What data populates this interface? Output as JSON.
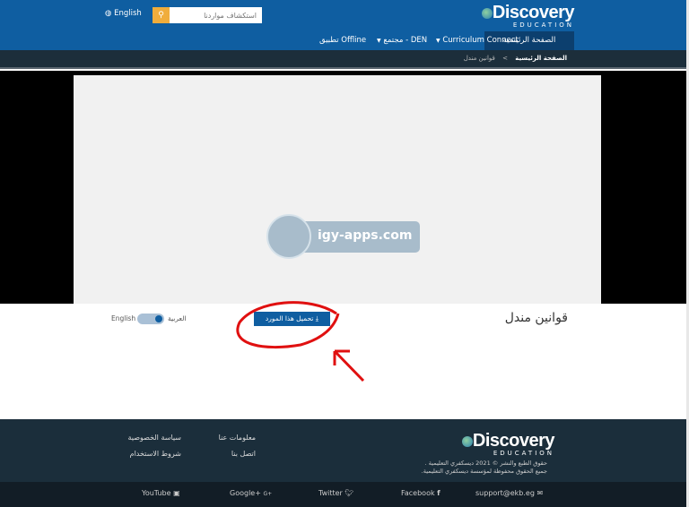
{
  "header": {
    "language_label": "English",
    "search_placeholder": "استكشاف مواردنا",
    "logo_text": "Discovery",
    "logo_sub": "EDUCATION",
    "nav": [
      {
        "label": "الصفحة الرئيسية"
      },
      {
        "label": "Curriculum Connect"
      },
      {
        "label": "مجتمع - DEN"
      },
      {
        "label": "تطبيق Offline"
      }
    ]
  },
  "breadcrumb": {
    "home": "الصفحة الرئيسية",
    "separator": ">",
    "current": "قوانين مندل"
  },
  "video": {
    "watermark": "igy-apps.com"
  },
  "content": {
    "title": "قوانين مندل",
    "download_label": "تحميل هذا المورد",
    "toggle_left": "English",
    "toggle_right": "العربية",
    "toggle_state": "العربية"
  },
  "footer": {
    "logo_text": "Discovery",
    "logo_sub": "EDUCATION",
    "copyright_1": "حقوق الطبع والنشر © 2021 ديسكفري التعليمية .",
    "copyright_2": "جميع الحقوق محفوظة لمؤسسة ديسكفري التعليمية.",
    "links": [
      "معلومات عنا",
      "اتصل بنا",
      "سياسة الخصوصية",
      "شروط الاستخدام"
    ],
    "social": [
      "YouTube",
      "Google+",
      "Twitter",
      "Facebook",
      "support@ekb.eg"
    ]
  },
  "colors": {
    "header": "#0f5ea1",
    "active_nav": "#0c3f6e",
    "search_button": "#f0ad3c",
    "download_button": "#0f5ea1",
    "footer": "#1b2e3b",
    "annotation": "#e01010"
  }
}
